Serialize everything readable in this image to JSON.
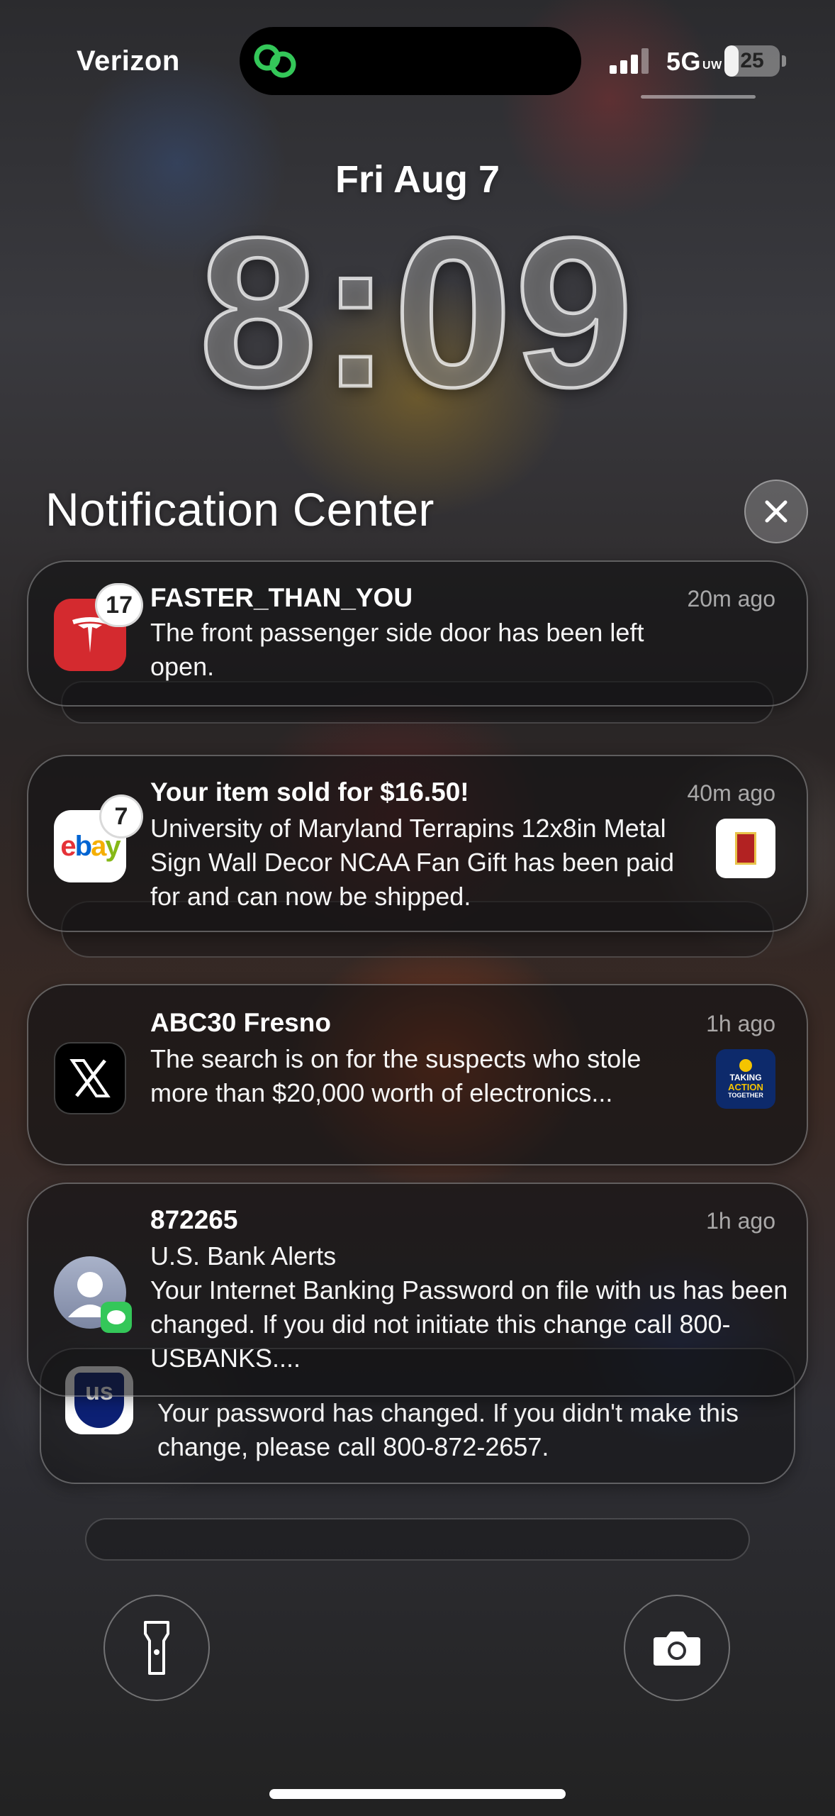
{
  "status": {
    "carrier": "Verizon",
    "network": "5G",
    "network_sub": "UW",
    "battery": "25",
    "battery_level": 0.25
  },
  "lock": {
    "date": "Fri Aug 7",
    "time": "8:09"
  },
  "notification_center": {
    "title": "Notification Center",
    "close_icon": "close-icon"
  },
  "notifications": [
    {
      "app": "Tesla",
      "icon": "tesla-icon",
      "badge": "17",
      "title": "FASTER_THAN_YOU",
      "time": "20m ago",
      "body": "The front passenger side door has been left open."
    },
    {
      "app": "eBay",
      "icon": "ebay-icon",
      "icon_text": "ebay",
      "badge": "7",
      "title": "Your item sold for $16.50!",
      "time": "40m ago",
      "body": "University of Maryland Terrapins 12x8in Metal Sign Wall Decor NCAA Fan Gift has been paid for and can now be shipped."
    },
    {
      "app": "X",
      "icon": "x-icon",
      "title": "ABC30 Fresno",
      "time": "1h ago",
      "body": "The search is on for the suspects who stole more than $20,000 worth of electronics...",
      "thumb_text": [
        "TAKING",
        "ACTION",
        "TOGETHER"
      ]
    },
    {
      "app": "Messages",
      "icon": "contact-avatar-icon",
      "title": "872265",
      "time": "1h ago",
      "subtitle": "U.S. Bank Alerts",
      "body": "Your Internet Banking Password on file with us has been changed. If you did not initiate this change call 800-USBANKS...."
    },
    {
      "app": "U.S. Bank",
      "icon": "usbank-icon",
      "icon_text": "us",
      "body": "Your password has changed. If you didn't make this change, please call 800-872-2657."
    }
  ],
  "controls": {
    "flashlight": "flashlight-icon",
    "camera": "camera-icon"
  },
  "colors": {
    "tesla_red": "#d42a2f",
    "ebay_red": "#e53238",
    "ebay_blue": "#0064d2",
    "ebay_yellow": "#f5af02",
    "ebay_green": "#86b817",
    "island_green": "#34c759",
    "usbank_blue": "#0c2074"
  }
}
